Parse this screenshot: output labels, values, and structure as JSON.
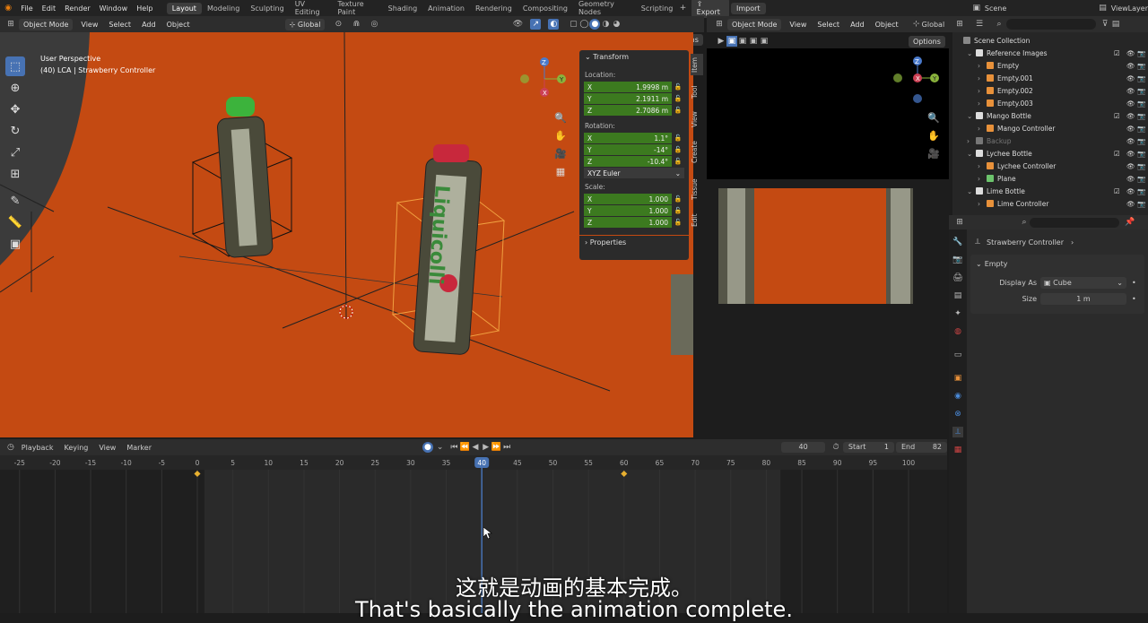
{
  "topbar": {
    "menus": [
      "File",
      "Edit",
      "Render",
      "Window",
      "Help"
    ],
    "workspaces": [
      "Layout",
      "Modeling",
      "Sculpting",
      "UV Editing",
      "Texture Paint",
      "Shading",
      "Animation",
      "Rendering",
      "Compositing",
      "Geometry Nodes",
      "Scripting"
    ],
    "active_workspace": "Layout",
    "export_label": "Export",
    "import_label": "Import",
    "scene": "Scene",
    "viewlayer": "ViewLayer"
  },
  "viewport_header": {
    "mode": "Object Mode",
    "menus": [
      "View",
      "Select",
      "Add",
      "Object"
    ],
    "orientation": "Global",
    "options": "Options"
  },
  "viewport": {
    "perspective": "User Perspective",
    "info": "(40) LCA | Strawberry Controller",
    "bottle_label": "Liquicolli"
  },
  "npanel": {
    "section": "Transform",
    "location_label": "Location:",
    "location": [
      {
        "axis": "X",
        "value": "1.9998 m"
      },
      {
        "axis": "Y",
        "value": "2.1911 m"
      },
      {
        "axis": "Z",
        "value": "2.7086 m"
      }
    ],
    "rotation_label": "Rotation:",
    "rotation": [
      {
        "axis": "X",
        "value": "1.1°"
      },
      {
        "axis": "Y",
        "value": "-14°"
      },
      {
        "axis": "Z",
        "value": "-10.4°"
      }
    ],
    "rotation_mode": "XYZ Euler",
    "scale_label": "Scale:",
    "scale": [
      {
        "axis": "X",
        "value": "1.000"
      },
      {
        "axis": "Y",
        "value": "1.000"
      },
      {
        "axis": "Z",
        "value": "1.000"
      }
    ],
    "properties": "Properties",
    "tabs": [
      "Item",
      "Tool",
      "View",
      "Create",
      "Tissue",
      "Edit"
    ]
  },
  "camera_header": {
    "mode": "Object Mode",
    "menus": [
      "View",
      "Select",
      "Add",
      "Object"
    ],
    "orientation": "Global",
    "options": "Options"
  },
  "outliner": {
    "root": "Scene Collection",
    "rows": [
      {
        "label": "Reference Images",
        "indent": 1,
        "type": "collection"
      },
      {
        "label": "Empty",
        "indent": 2,
        "type": "object"
      },
      {
        "label": "Empty.001",
        "indent": 2,
        "type": "object"
      },
      {
        "label": "Empty.002",
        "indent": 2,
        "type": "object"
      },
      {
        "label": "Empty.003",
        "indent": 2,
        "type": "object"
      },
      {
        "label": "Mango Bottle",
        "indent": 1,
        "type": "collection"
      },
      {
        "label": "Mango Controller",
        "indent": 2,
        "type": "object"
      },
      {
        "label": "Backup",
        "indent": 1,
        "type": "collection-disabled"
      },
      {
        "label": "Lychee Bottle",
        "indent": 1,
        "type": "collection"
      },
      {
        "label": "Lychee Controller",
        "indent": 2,
        "type": "object"
      },
      {
        "label": "Plane",
        "indent": 2,
        "type": "mesh"
      },
      {
        "label": "Lime Bottle",
        "indent": 1,
        "type": "collection"
      },
      {
        "label": "Lime Controller",
        "indent": 2,
        "type": "object"
      }
    ]
  },
  "properties": {
    "object": "Strawberry Controller",
    "section": "Empty",
    "display_as_label": "Display As",
    "display_as_value": "Cube",
    "size_label": "Size",
    "size_value": "1 m"
  },
  "timeline": {
    "menus": [
      "Playback",
      "Keying",
      "View",
      "Marker"
    ],
    "current_frame": "40",
    "start_label": "Start",
    "start": "1",
    "end_label": "End",
    "end": "82",
    "ticks": [
      "-25",
      "-20",
      "-15",
      "-10",
      "-5",
      "0",
      "5",
      "10",
      "15",
      "20",
      "25",
      "30",
      "35",
      "40",
      "45",
      "50",
      "55",
      "60",
      "65",
      "70",
      "75",
      "80",
      "85",
      "90",
      "95",
      "100"
    ],
    "keyframes": [
      0,
      60
    ]
  },
  "subtitles": {
    "zh": "这就是动画的基本完成。",
    "en": "That's basically the animation complete."
  },
  "colors": {
    "accent_blue": "#4772b3",
    "floor_orange": "#c44a12",
    "field_green": "#3c7a1f"
  }
}
